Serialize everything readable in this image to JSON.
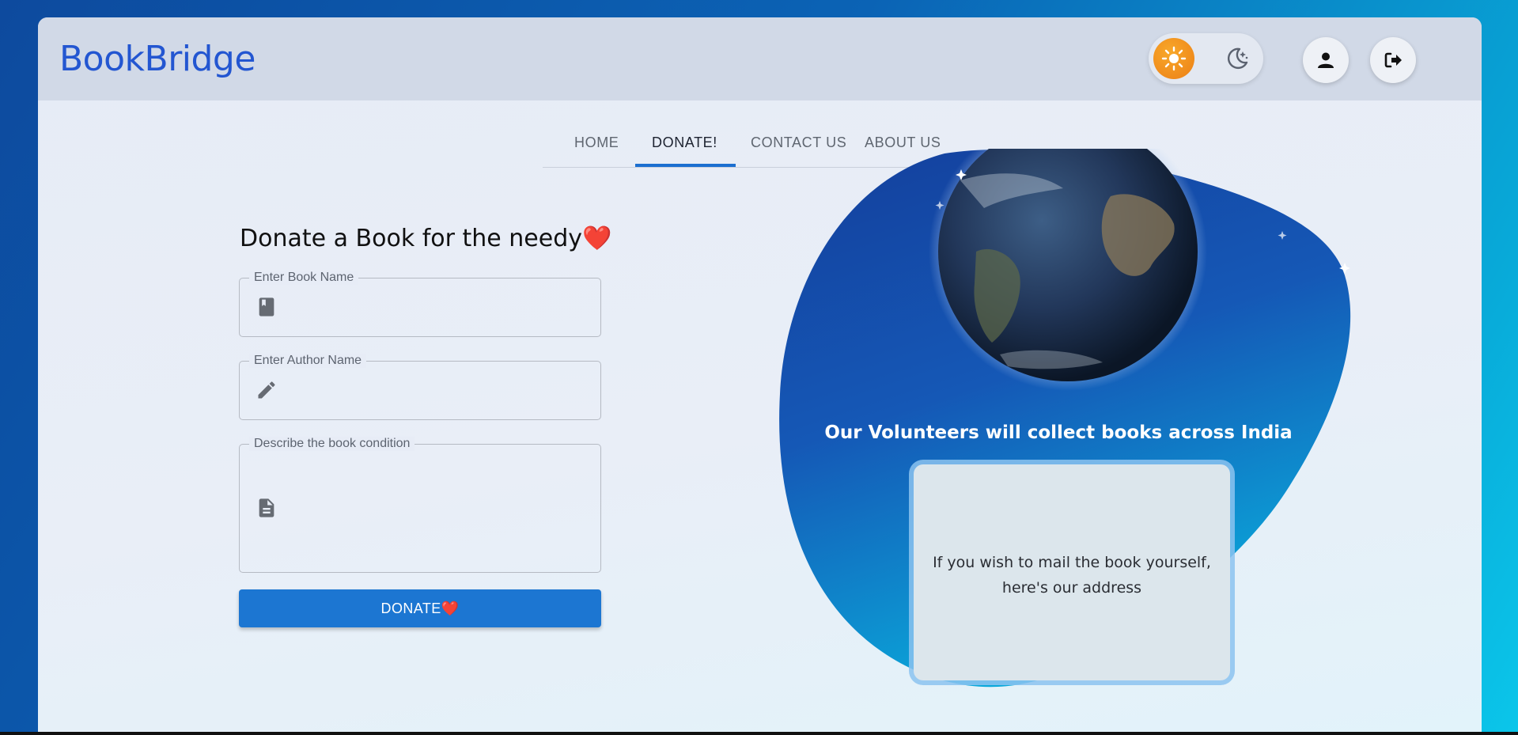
{
  "app": {
    "name": "BookBridge"
  },
  "header": {
    "theme_toggle": {
      "light_icon": "sun-icon",
      "dark_icon": "moon-stars-icon",
      "active": "light"
    },
    "profile_icon": "user-icon",
    "logout_icon": "logout-icon"
  },
  "nav": {
    "tabs": [
      {
        "label": "HOME"
      },
      {
        "label": "DONATE!"
      },
      {
        "label": "CONTACT US"
      },
      {
        "label": "ABOUT US"
      }
    ],
    "active_tab": "DONATE!"
  },
  "form": {
    "title": "Donate a Book for the needy",
    "title_emoji": "❤️",
    "book_name": {
      "label": "Enter Book Name",
      "value": "",
      "icon": "book-icon"
    },
    "author_name": {
      "label": "Enter Author Name",
      "value": "",
      "icon": "pencil-icon"
    },
    "condition": {
      "label": "Describe the book condition",
      "value": "",
      "icon": "document-icon"
    },
    "submit_label": "DONATE",
    "submit_emoji": "❤️"
  },
  "hero": {
    "caption": "Our Volunteers will collect books across India",
    "card_text": "If you wish to mail the book yourself, here's our address",
    "image": "earth-globe"
  },
  "colors": {
    "brand": "#2356d1",
    "accent": "#1c76d2",
    "sun": "#ec7f16",
    "heart": "#e0283e"
  }
}
